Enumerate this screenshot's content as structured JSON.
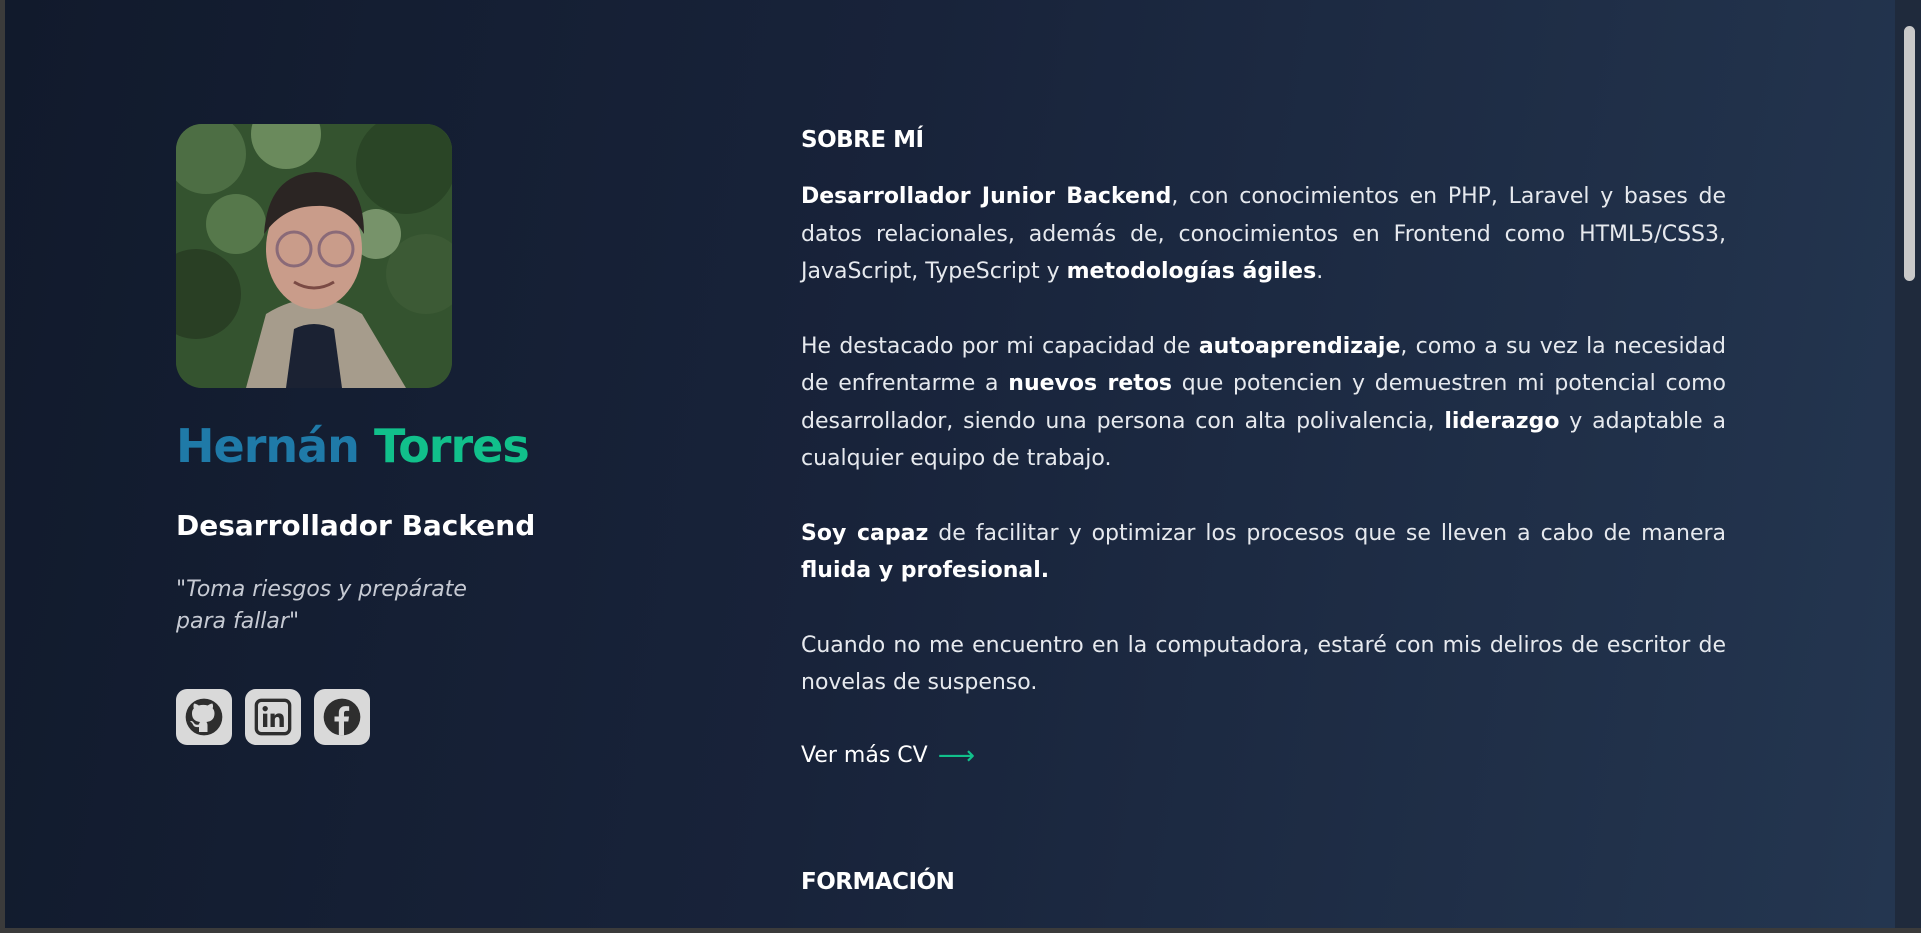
{
  "profile": {
    "photo_alt": "Foto de perfil",
    "first_name": "Hernán",
    "last_name": "Torres",
    "role": "Desarrollador Backend",
    "quote_line1": "\"Toma riesgos y prepárate",
    "quote_line2": "para fallar\""
  },
  "socials": [
    {
      "name": "github",
      "icon": "github-icon"
    },
    {
      "name": "linkedin",
      "icon": "linkedin-icon"
    },
    {
      "name": "facebook",
      "icon": "facebook-icon"
    }
  ],
  "about": {
    "title": "SOBRE MÍ",
    "p1": {
      "b1": "Desarrollador Junior Backend",
      "t1": ", con conocimientos en PHP, Laravel y bases de datos relacionales, además de, conocimientos en Frontend como HTML5/CSS3, JavaScript, TypeScript y ",
      "b2": "metodologías ágiles",
      "t2": "."
    },
    "p2": {
      "t1": "He destacado por mi capacidad de ",
      "b1": "autoaprendizaje",
      "t2": ", como a su vez la necesidad de enfrentarme a ",
      "b2": "nuevos retos",
      "t3": " que potencien y demuestren mi potencial como desarrollador, siendo una persona con alta polivalencia, ",
      "b3": "liderazgo",
      "t4": " y adaptable a cualquier equipo de trabajo."
    },
    "p3": {
      "b1": "Soy capaz",
      "t1": " de facilitar y optimizar los procesos que se lleven a cabo de manera ",
      "b2": "fluida y profesional."
    },
    "p4": {
      "t1": "Cuando no me encuentro en la computadora, estaré con mis deliros de escritor de novelas de suspenso."
    },
    "cv_link": "Ver más CV",
    "cv_arrow": "⟶"
  },
  "formacion": {
    "title": "FORMACIÓN"
  },
  "colors": {
    "name_first": "#1f7aa8",
    "name_last": "#11c08b",
    "accent": "#11c08b",
    "background": "#151f33"
  }
}
